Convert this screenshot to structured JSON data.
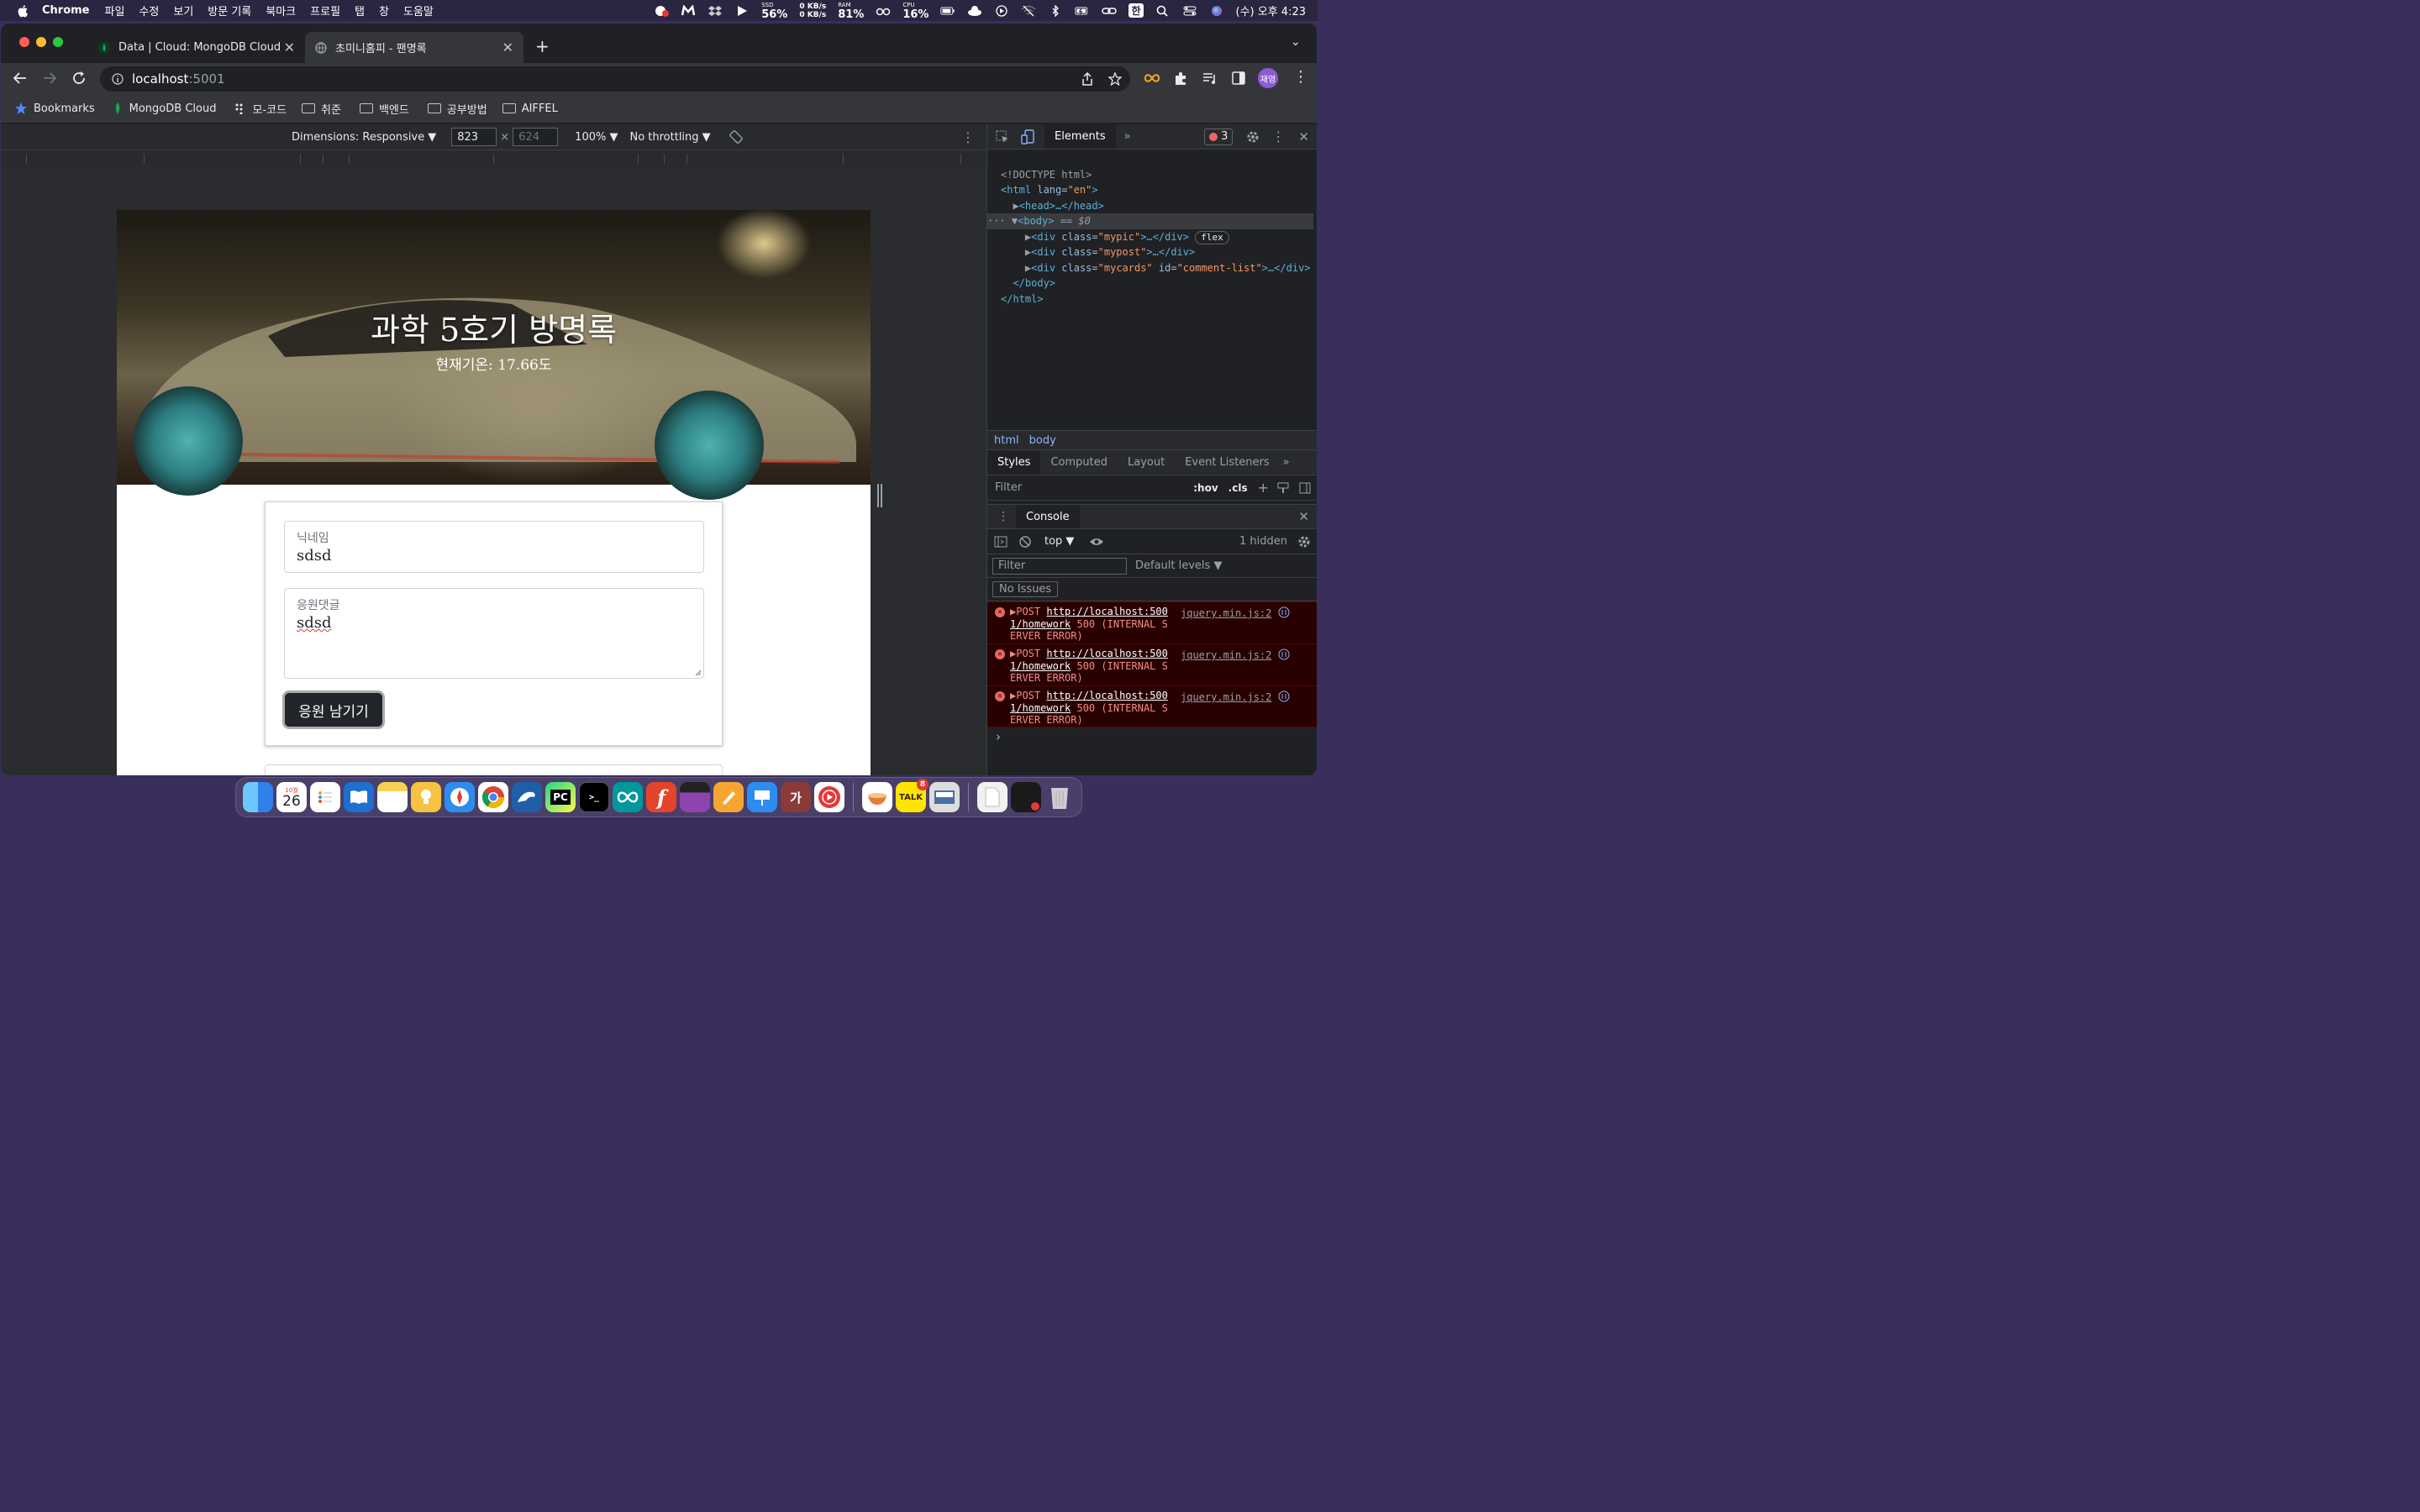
{
  "menubar": {
    "app_name": "Chrome",
    "items": [
      "파일",
      "수정",
      "보기",
      "방문 기록",
      "북마크",
      "프로필",
      "탭",
      "창",
      "도움말"
    ],
    "ssd_label": "SSD",
    "ssd_value": "56%",
    "net_up": "0 KB/s",
    "net_down": "0 KB/s",
    "ram_label": "RAM",
    "ram_value": "81%",
    "cpu_label": "CPU",
    "cpu_value": "16%",
    "input_lang": "한",
    "datetime": "(수) 오후 4:23"
  },
  "browser": {
    "tabs": [
      {
        "title": "Data | Cloud: MongoDB Cloud",
        "icon": "mongodb-leaf-icon"
      },
      {
        "title": "초미니홈피 - 팬명록",
        "icon": "globe-icon"
      }
    ],
    "address_host": "localhost",
    "address_port": ":5001",
    "profile_initials": "재영",
    "bookmarks": [
      {
        "label": "Bookmarks",
        "icon": "star-icon"
      },
      {
        "label": "MongoDB Cloud",
        "icon": "mongodb-leaf-icon"
      },
      {
        "label": "모-코드",
        "icon": "dots-icon"
      },
      {
        "label": "취준",
        "icon": "folder-icon"
      },
      {
        "label": "백엔드",
        "icon": "folder-icon"
      },
      {
        "label": "공부방법",
        "icon": "folder-icon"
      },
      {
        "label": "AIFFEL",
        "icon": "folder-icon"
      }
    ]
  },
  "device_toolbar": {
    "dimensions_label": "Dimensions: Responsive ▼",
    "width": "823",
    "times": "×",
    "height_placeholder": "624",
    "zoom": "100% ▼",
    "throttling": "No throttling ▼"
  },
  "page": {
    "title": "과학 5호기 방명록",
    "subtitle": "현재기온: 17.66도",
    "nickname_label": "닉네임",
    "nickname_value": "sdsd",
    "comment_label": "응원댓글",
    "comment_value": "sdsd",
    "submit_label": "응원 남기기"
  },
  "devtools": {
    "top_tab": "Elements",
    "error_count": "3",
    "dom_lines": {
      "doctype": "<!DOCTYPE html>",
      "html_open_tag": "<html",
      "html_attr": " lang=",
      "html_attr_val": "\"en\"",
      "head": "<head>…</head>",
      "body_open": "<body>",
      "body_marker": " == $0",
      "div": "<div",
      "class_attr": " class=",
      "mypic": "\"mypic\"",
      "mypost": "\"mypost\"",
      "mycards": "\"mycards\"",
      "id_attr": " id=",
      "comment_list": "\"comment-list\"",
      "div_close": ">…</div>",
      "flex_badge": "flex",
      "body_close": "</body>",
      "html_close": "</html>"
    },
    "breadcrumb": [
      "html",
      "body"
    ],
    "style_tabs": [
      "Styles",
      "Computed",
      "Layout",
      "Event Listeners"
    ],
    "filter_placeholder": "Filter",
    "hov": ":hov",
    "cls": ".cls",
    "console_tab": "Console",
    "context": "top ▼",
    "hidden_count": "1 hidden",
    "console_filter_placeholder": "Filter",
    "levels": "Default levels ▼",
    "no_issues": "No Issues",
    "errors": [
      {
        "method": "POST",
        "url": "http://localhost:5001/homework",
        "status": "500 (INTERNAL SERVER ERROR)",
        "source": "jquery.min.js:2"
      },
      {
        "method": "POST",
        "url": "http://localhost:5001/homework",
        "status": "500 (INTERNAL SERVER ERROR)",
        "source": "jquery.min.js:2"
      },
      {
        "method": "POST",
        "url": "http://localhost:5001/homework",
        "status": "500 (INTERNAL SERVER ERROR)",
        "source": "jquery.min.js:2"
      }
    ],
    "prompt": "›"
  },
  "dock": {
    "calendar_month": "10월",
    "calendar_day": "26",
    "talk_label": "TALK",
    "talk_badge": "8",
    "ga_label": "가"
  }
}
